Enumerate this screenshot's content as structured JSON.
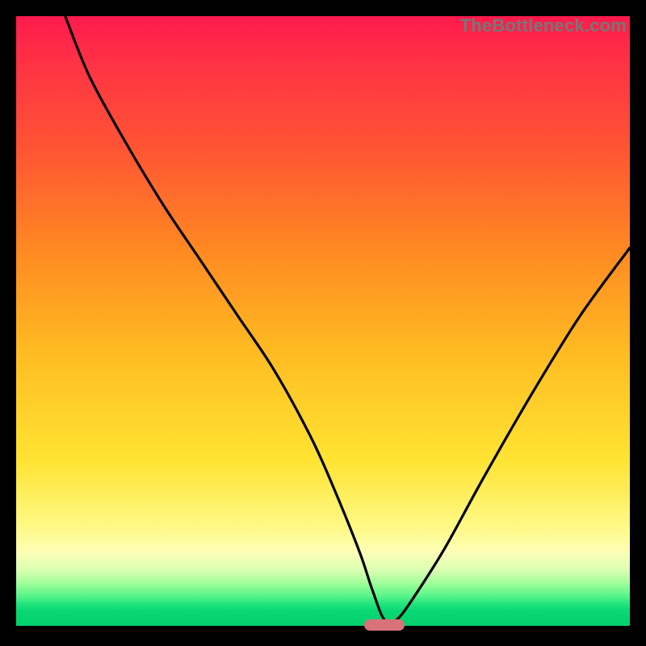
{
  "attribution": "TheBottleneck.com",
  "colors": {
    "frame": "#000000",
    "pill": "#d9727a",
    "curve": "#000000"
  },
  "chart_data": {
    "type": "line",
    "title": "",
    "xlabel": "",
    "ylabel": "",
    "xlim": [
      0,
      100
    ],
    "ylim": [
      0,
      100
    ],
    "grid": false,
    "series": [
      {
        "name": "bottleneck-curve",
        "x": [
          8,
          12,
          18,
          24,
          30,
          36,
          42,
          48,
          52,
          56,
          58,
          60,
          62,
          65,
          70,
          76,
          84,
          92,
          100
        ],
        "values": [
          100,
          90,
          79,
          69,
          60,
          51,
          42,
          31,
          22,
          12,
          6,
          1,
          1,
          5,
          13,
          24,
          38,
          51,
          62
        ]
      }
    ],
    "marker": {
      "x": 60,
      "y": 0,
      "width_pct": 6.5,
      "height_pct": 1.8
    }
  }
}
